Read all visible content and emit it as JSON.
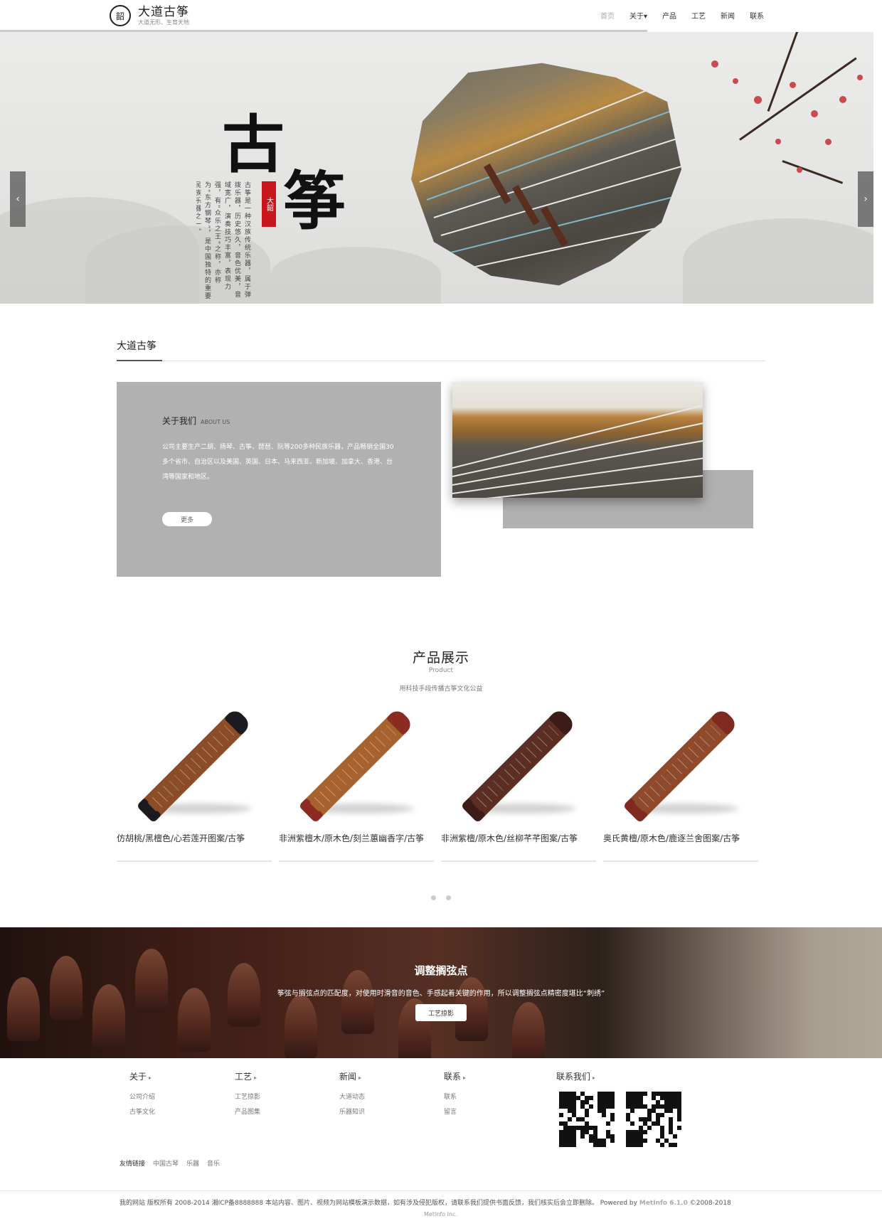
{
  "site": {
    "logo_seal": "韶",
    "name": "大道古筝",
    "tagline": "大道无形、生育天地"
  },
  "nav": {
    "items": [
      {
        "label": "首页",
        "active": true
      },
      {
        "label": "关于▾",
        "active": false
      },
      {
        "label": "产品",
        "active": false
      },
      {
        "label": "工艺",
        "active": false
      },
      {
        "label": "新闻",
        "active": false
      },
      {
        "label": "联系",
        "active": false
      }
    ]
  },
  "hero": {
    "char_1": "古",
    "char_2": "筝",
    "seal_text": "大韶",
    "vertical_text": "古筝是一种汉族传统乐器，属于弹拨乐器，历史悠久，音色优美，音域宽广，演奏技巧丰富，表现力强，有“众乐之王”之称，亦称为“东方钢琴”，是中国独特的重要民族乐器之一。",
    "prev_arrow": "‹",
    "next_arrow": "›"
  },
  "about": {
    "section_title": "大道古筝",
    "heading": "关于我们",
    "heading_en": "ABOUT US",
    "body": "公司主要生产二胡、扬琴、古筝、琵琶、阮等200多种民族乐器，产品畅销全国30多个省市、自治区以及美国、英国、日本、马来西亚、新加坡、加拿大、香港、台湾等国家和地区。",
    "more_label": "更多"
  },
  "products": {
    "title": "产品展示",
    "subtitle": "Product",
    "description": "用科技手段传播古筝文化公益",
    "items": [
      {
        "name": "仿胡桃/黑檀色/心若莲开图案/古筝",
        "body_color": "#8a4d28",
        "end_color": "#1b1b1f"
      },
      {
        "name": "非洲紫檀木/原木色/刻兰蕙幽香字/古筝",
        "body_color": "#a6622f",
        "end_color": "#8c2b22"
      },
      {
        "name": "非洲紫檀/原木色/丝柳芊芊图案/古筝",
        "body_color": "#5a2e22",
        "end_color": "#3b1c17"
      },
      {
        "name": "奥氏黄檀/原木色/鹿逐兰舍图案/古筝",
        "body_color": "#8e4a2a",
        "end_color": "#7e2a20"
      }
    ]
  },
  "craft": {
    "title": "调整搁弦点",
    "description": "筝弦与搁弦点的匹配度，对使用时滑音的音色、手感起着关键的作用，所以调整搁弦点精密度堪比“刺绣”",
    "button_label": "工艺掠影"
  },
  "footer": {
    "columns": [
      {
        "head": "关于",
        "links": [
          "公司介绍",
          "古筝文化"
        ]
      },
      {
        "head": "工艺",
        "links": [
          "工艺掠影",
          "产品图集"
        ]
      },
      {
        "head": "新闻",
        "links": [
          "大道动态",
          "乐器知识"
        ]
      },
      {
        "head": "联系",
        "links": [
          "联系",
          "留言"
        ]
      }
    ],
    "contact_head": "联系我们",
    "caret": "▸",
    "friend_label": "友情链接",
    "friend_links": [
      "中国古琴",
      "乐器",
      "音乐"
    ],
    "copyright": "我的网站 版权所有 2008-2014 湘ICP备8888888 本站内容、图片、视频为网站模板演示数据，如有涉及侵犯版权，请联系我们提供书面反馈，我们核实后会立即删除。 Powered by",
    "powered_brand": "MetInfo 6.1.0",
    "powered_years": "©2008-2018",
    "company": "MetInfo Inc."
  }
}
